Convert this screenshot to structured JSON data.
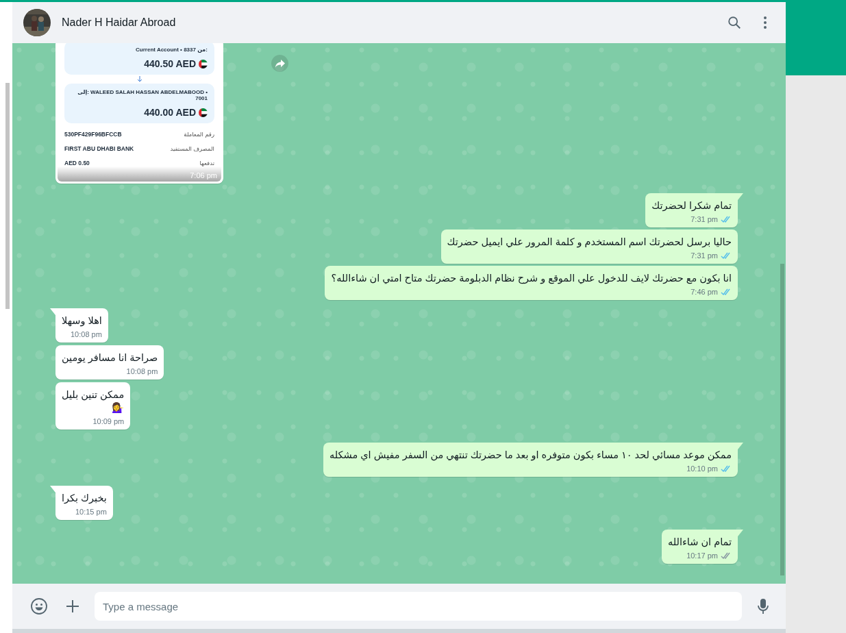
{
  "chat": {
    "title": "Nader H Haidar Abroad"
  },
  "receipt": {
    "from_label": "من:",
    "from_account": "Current Account • 8337",
    "from_amount": "440.50 AED",
    "to_label": "إلى:",
    "to_name": "WALEED SALAH HASSAN ABDELMABOOD • 7001",
    "to_amount": "440.00 AED",
    "rows": [
      {
        "label": "رقم المعاملة",
        "value": "530PF429F96BFCCB"
      },
      {
        "label": "المصرف المستفيد",
        "value": "FIRST ABU DHABI BANK"
      },
      {
        "label": "تدفعها",
        "value": "AED 0.50"
      }
    ],
    "time": "7:06 pm"
  },
  "messages": [
    {
      "outgoing": true,
      "text": "تمام شكرا لحضرتك",
      "time": "7:31 pm",
      "read": true
    },
    {
      "outgoing": true,
      "text": "حاليا برسل لحضرتك اسم المستخدم و كلمة المرور علي ايميل حضرتك",
      "time": "7:31 pm",
      "read": true
    },
    {
      "outgoing": true,
      "text": "انا بكون مع حضرتك لايف للدخول علي الموقع و شرح نظام الدبلومة حضرتك متاح امتي ان شاءالله؟",
      "time": "7:46 pm",
      "read": true
    },
    {
      "outgoing": false,
      "text": "اهلا وسهلا",
      "time": "10:08 pm"
    },
    {
      "outgoing": false,
      "text": "صراحة انا مسافر يومين",
      "time": "10:08 pm"
    },
    {
      "outgoing": false,
      "text": "ممكن تنين بليل\n💁‍♀️",
      "time": "10:09 pm"
    },
    {
      "outgoing": true,
      "text": "ممكن موعد مسائي لحد ١٠ مساء بكون متوفره او بعد ما حضرتك تنتهي من السفر مفيش اي مشكله",
      "time": "10:10 pm",
      "read": true
    },
    {
      "outgoing": false,
      "text": "بخبرك بكرا",
      "time": "10:15 pm"
    },
    {
      "outgoing": true,
      "text": "تمام ان شاءالله",
      "time": "10:17 pm",
      "read": false
    }
  ],
  "composer": {
    "placeholder": "Type a message"
  }
}
